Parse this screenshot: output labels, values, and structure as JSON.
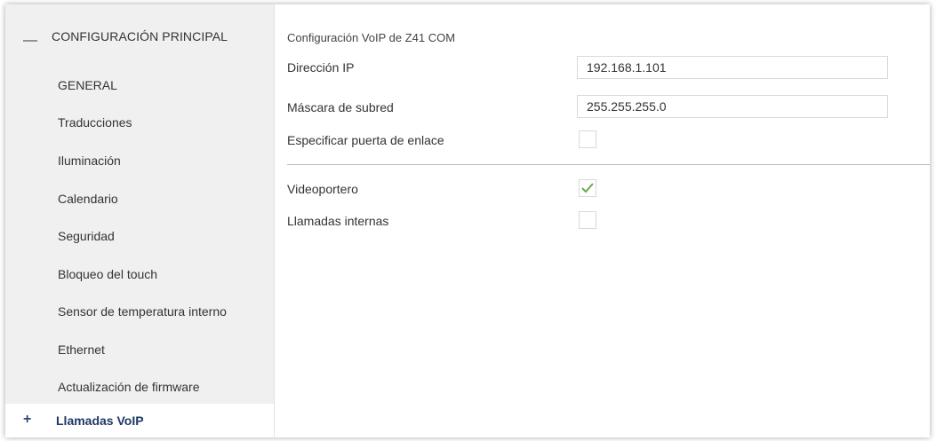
{
  "sidebar": {
    "header_title": "CONFIGURACIÓN PRINCIPAL",
    "items": [
      {
        "label": "GENERAL"
      },
      {
        "label": "Traducciones"
      },
      {
        "label": "Iluminación"
      },
      {
        "label": "Calendario"
      },
      {
        "label": "Seguridad"
      },
      {
        "label": "Bloqueo del touch"
      },
      {
        "label": "Sensor de temperatura interno"
      },
      {
        "label": "Ethernet"
      },
      {
        "label": "Actualización de firmware"
      }
    ],
    "footer_label": "Llamadas VoIP",
    "collapse_icon": "minus-icon",
    "expand_icon": "plus-icon"
  },
  "main": {
    "section_title": "Configuración VoIP de Z41 COM",
    "ip_label": "Dirección IP",
    "ip_value": "192.168.1.101",
    "mask_label": "Máscara de subred",
    "mask_value": "255.255.255.0",
    "gateway_label": "Especificar puerta de enlace",
    "gateway_checked": false,
    "videoportero_label": "Videoportero",
    "videoportero_checked": true,
    "internal_calls_label": "Llamadas internas",
    "internal_calls_checked": false
  },
  "colors": {
    "check": "#6aaa4b",
    "accent": "#1f3a66",
    "sidebar_bg": "#f0f0f0"
  }
}
